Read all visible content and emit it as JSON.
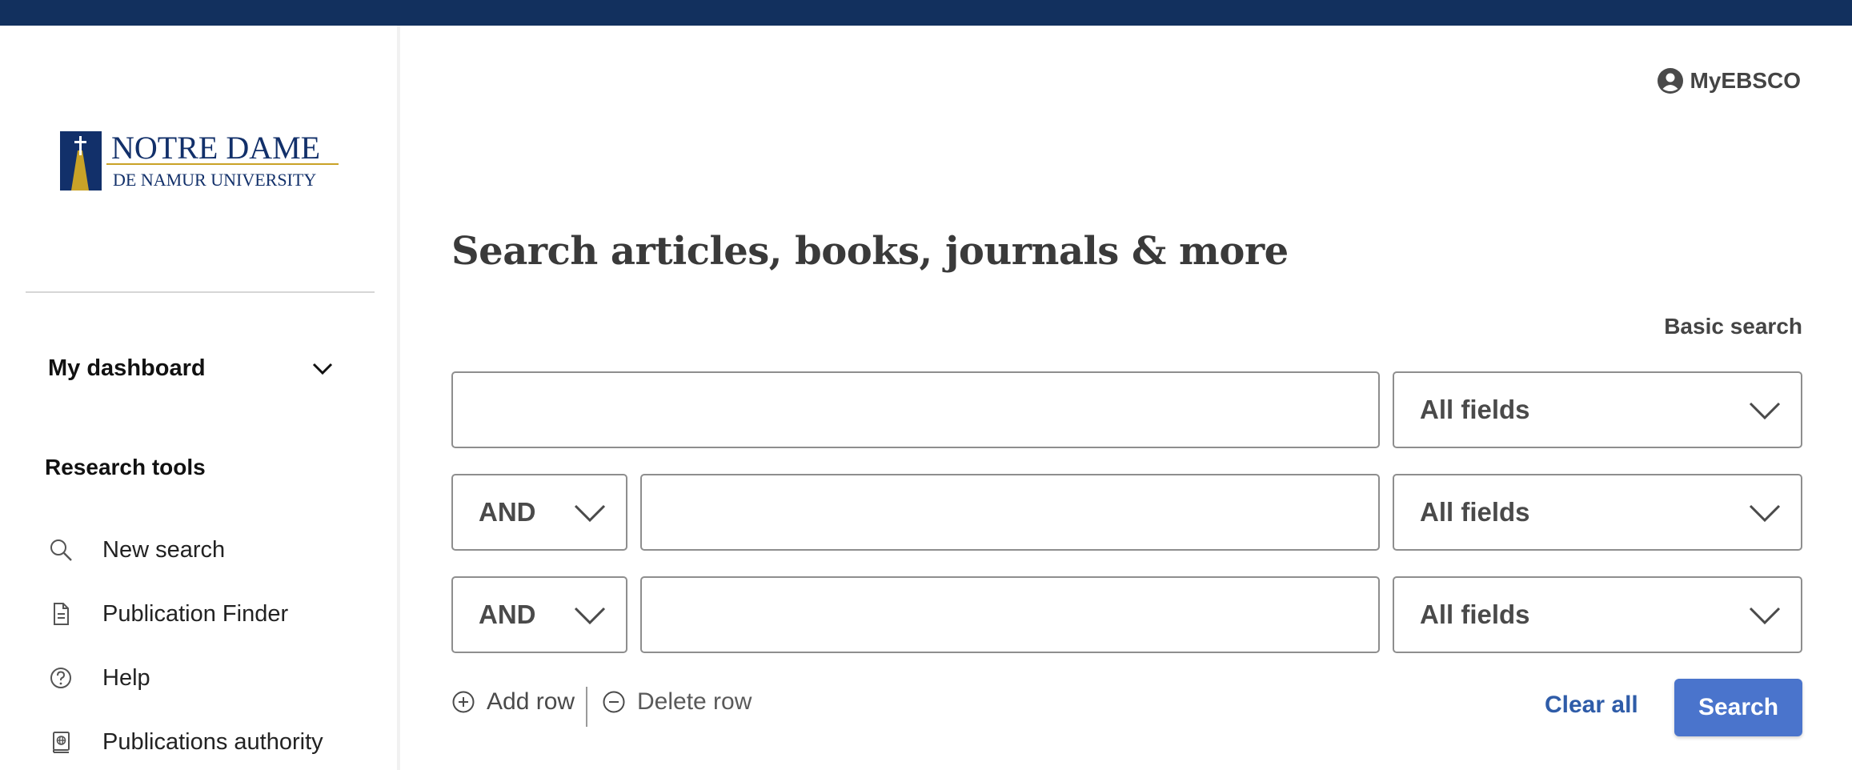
{
  "colors": {
    "topbar": "#12305e",
    "accent": "#2f5ca8",
    "search_button": "#4a74cc",
    "logo_blue": "#12306a",
    "logo_gold": "#c9a227"
  },
  "logo": {
    "line1": "NOTRE DAME",
    "line2": "DE NAMUR UNIVERSITY"
  },
  "header": {
    "account_label": "MyEBSCO",
    "account_icon": "user-circle-icon"
  },
  "sidebar": {
    "dashboard_label": "My dashboard",
    "research_tools_heading": "Research tools",
    "tools": [
      {
        "label": "New search",
        "icon": "search-icon"
      },
      {
        "label": "Publication Finder",
        "icon": "document-icon"
      },
      {
        "label": "Help",
        "icon": "help-icon"
      },
      {
        "label": "Publications authority",
        "icon": "book-globe-icon"
      }
    ]
  },
  "main": {
    "headline": "Search articles, books, journals & more",
    "mode_toggle": "Basic search",
    "rows": [
      {
        "operator": null,
        "value": "",
        "field": "All fields"
      },
      {
        "operator": "AND",
        "value": "",
        "field": "All fields"
      },
      {
        "operator": "AND",
        "value": "",
        "field": "All fields"
      }
    ],
    "add_row_label": "Add row",
    "delete_row_label": "Delete row",
    "clear_all_label": "Clear all",
    "search_button_label": "Search"
  }
}
